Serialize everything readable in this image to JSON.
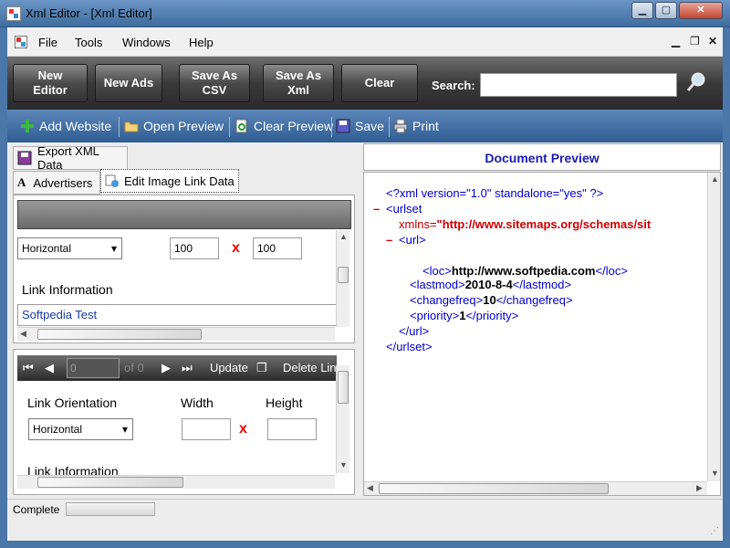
{
  "window": {
    "title": "Xml Editor - [Xml Editor]"
  },
  "menu": {
    "items": [
      "File",
      "Tools",
      "Windows",
      "Help"
    ]
  },
  "toolbar": {
    "new_editor": "New\nEditor",
    "new_ads": "New Ads",
    "save_csv": "Save As\nCSV",
    "save_xml": "Save As\nXml",
    "clear": "Clear",
    "search_label": "Search:",
    "search_value": ""
  },
  "actions": {
    "add_website": "Add Website",
    "open_preview": "Open Preview",
    "clear_preview": "Clear Preview",
    "save": "Save",
    "print": "Print"
  },
  "left": {
    "export_tab": "Export XML Data",
    "advertisers_tab": "Advertisers",
    "edit_tab": "Edit Image Link Data",
    "upper": {
      "orientation": "Horizontal",
      "width": "100",
      "height": "100",
      "x_mark": "x",
      "link_info_label": "Link Information",
      "link_info_value": "Softpedia Test"
    },
    "lower": {
      "position": "0",
      "of_count": "of 0",
      "update": "Update",
      "delete": "Delete Lin",
      "orientation_label": "Link Orientation",
      "width_label": "Width",
      "height_label": "Height",
      "orientation": "Horizontal",
      "width": "",
      "height": "",
      "x_mark": "x",
      "link_info_label": "Link Information"
    }
  },
  "preview": {
    "title": "Document Preview",
    "minus": "–",
    "decl": "<?xml version=\"1.0\" standalone=\"yes\" ?>",
    "urlset_open": "<urlset",
    "xmlns_attr": "xmlns=",
    "xmlns_value": "\"http://www.sitemaps.org/schemas/sit",
    "url_open": "<url>",
    "loc_open": "<loc>",
    "loc_value": "http://www.softpedia.com",
    "loc_close": "</loc>",
    "lastmod_open": "<lastmod>",
    "lastmod_value": "2010-8-4",
    "lastmod_close": "</lastmod>",
    "changefreq_open": "<changefreq>",
    "changefreq_value": "10",
    "changefreq_close": "</changefreq>",
    "priority_open": "<priority>",
    "priority_value": "1",
    "priority_close": "</priority>",
    "url_close": "</url>",
    "urlset_close": "</urlset>"
  },
  "status": {
    "text": "Complete"
  },
  "colors": {
    "toolbar_dark": "#3a3a3a",
    "action_blue": "#2f5d93",
    "preview_title": "#1a1ab0",
    "xml_tag": "#0000cc",
    "x_mark": "#e00000"
  }
}
